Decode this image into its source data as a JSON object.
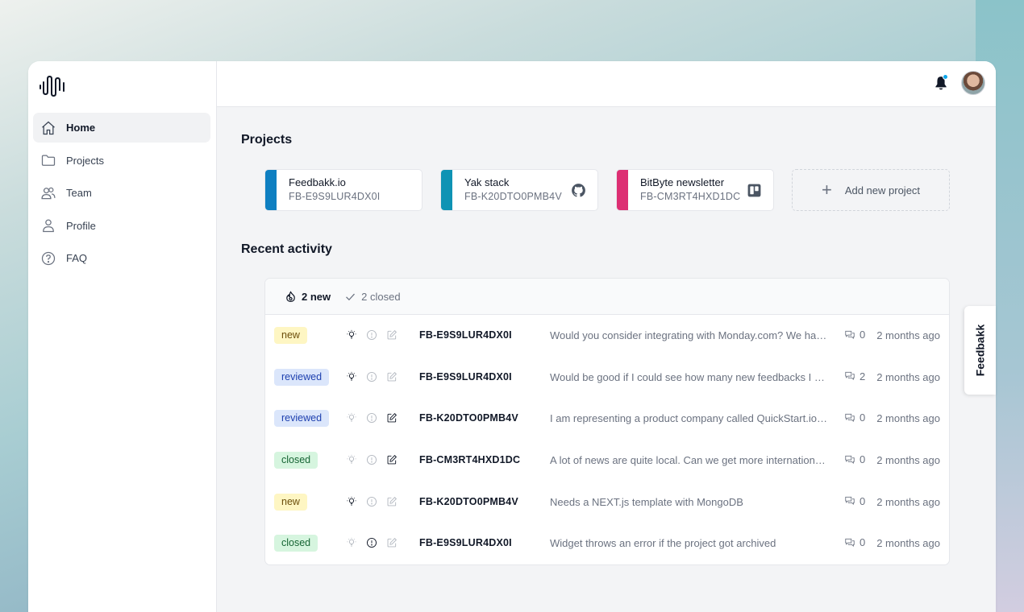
{
  "sidebar": {
    "items": [
      {
        "label": "Home",
        "icon": "home-icon"
      },
      {
        "label": "Projects",
        "icon": "folder-icon"
      },
      {
        "label": "Team",
        "icon": "team-icon"
      },
      {
        "label": "Profile",
        "icon": "user-icon"
      },
      {
        "label": "FAQ",
        "icon": "question-icon"
      }
    ]
  },
  "header": {
    "notification_icon": "bell-icon",
    "notification_dot_color": "#0ea5e9"
  },
  "projects_section": {
    "title": "Projects",
    "projects": [
      {
        "name": "Feedbakk.io",
        "id": "FB-E9S9LUR4DX0I",
        "color": "#0e7fc1",
        "icon": ""
      },
      {
        "name": "Yak stack",
        "id": "FB-K20DTO0PMB4V",
        "color": "#0f93b4",
        "icon": "github-icon"
      },
      {
        "name": "BitByte newsletter",
        "id": "FB-CM3RT4HXD1DC",
        "color": "#dd2f73",
        "icon": "trello-icon"
      }
    ],
    "add_label": "Add new project"
  },
  "activity": {
    "title": "Recent activity",
    "filters": [
      {
        "label": "2 new",
        "icon": "flame-icon",
        "active": true
      },
      {
        "label": "2 closed",
        "icon": "check-icon",
        "active": false
      }
    ],
    "rows": [
      {
        "status": "new",
        "idea": true,
        "issue": false,
        "other": false,
        "id": "FB-E9S9LUR4DX0I",
        "text": "Would you consider integrating with Monday.com? We have been using it for a while now",
        "comments": "0",
        "time": "2 months ago"
      },
      {
        "status": "reviewed",
        "idea": true,
        "issue": false,
        "other": false,
        "id": "FB-E9S9LUR4DX0I",
        "text": "Would be good if I could see how many new feedbacks I have received",
        "comments": "2",
        "time": "2 months ago"
      },
      {
        "status": "reviewed",
        "idea": false,
        "issue": false,
        "other": true,
        "id": "FB-K20DTO0PMB4V",
        "text": "I am representing a product company called QuickStart.io and we would like",
        "comments": "0",
        "time": "2 months ago"
      },
      {
        "status": "closed",
        "idea": false,
        "issue": false,
        "other": true,
        "id": "FB-CM3RT4HXD1DC",
        "text": "A lot of news are quite local. Can we get more international news?",
        "comments": "0",
        "time": "2 months ago"
      },
      {
        "status": "new",
        "idea": true,
        "issue": false,
        "other": false,
        "id": "FB-K20DTO0PMB4V",
        "text": "Needs a NEXT.js template with MongoDB",
        "comments": "0",
        "time": "2 months ago"
      },
      {
        "status": "closed",
        "idea": false,
        "issue": true,
        "other": false,
        "id": "FB-E9S9LUR4DX0I",
        "text": "Widget throws an error if the project got archived",
        "comments": "0",
        "time": "2 months ago"
      }
    ]
  },
  "feedback_tab": {
    "label": "Feedbakk"
  }
}
